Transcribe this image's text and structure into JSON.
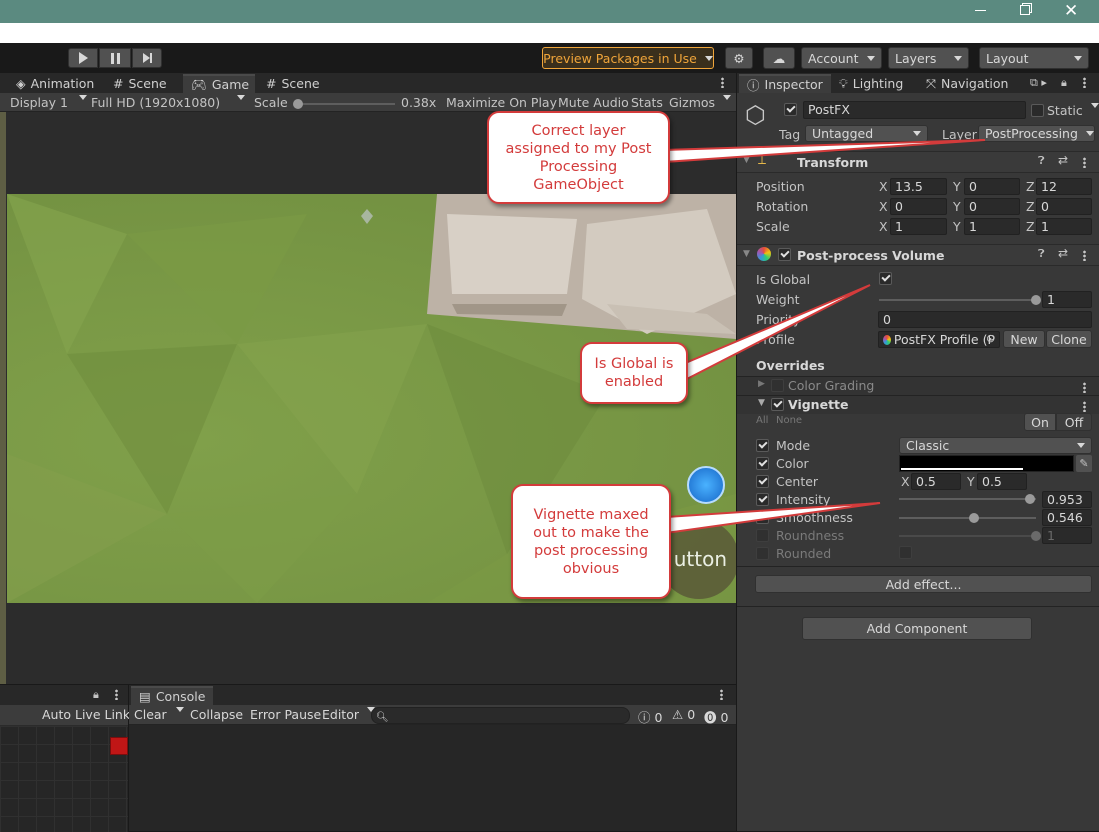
{
  "toolbar": {
    "preview_packages": "Preview Packages in Use",
    "account": "Account",
    "layers": "Layers",
    "layout": "Layout"
  },
  "game_tabs": [
    {
      "label": "Animation"
    },
    {
      "label": "Scene"
    },
    {
      "label": "Game"
    },
    {
      "label": "Scene"
    }
  ],
  "game_bar": {
    "display": "Display 1",
    "resolution": "Full HD (1920x1080)",
    "scale_label": "Scale",
    "scale_value": "0.38x",
    "maximize": "Maximize On Play",
    "mute": "Mute Audio",
    "stats": "Stats",
    "gizmos": "Gizmos"
  },
  "game_view": {
    "button_text": "utton"
  },
  "inspector_tabs": [
    {
      "label": "Inspector"
    },
    {
      "label": "Lighting"
    },
    {
      "label": "Navigation"
    }
  ],
  "gameobject": {
    "name": "PostFX",
    "static": "Static",
    "tag_label": "Tag",
    "tag": "Untagged",
    "layer_label": "Layer",
    "layer": "PostProcessing"
  },
  "transform": {
    "title": "Transform",
    "position": {
      "label": "Position",
      "x": "13.5",
      "y": "0",
      "z": "12"
    },
    "rotation": {
      "label": "Rotation",
      "x": "0",
      "y": "0",
      "z": "0"
    },
    "scale": {
      "label": "Scale",
      "x": "1",
      "y": "1",
      "z": "1"
    }
  },
  "axes": {
    "x": "X",
    "y": "Y",
    "z": "Z"
  },
  "volume": {
    "title": "Post-process Volume",
    "is_global": "Is Global",
    "weight_label": "Weight",
    "weight": "1",
    "weight_fraction": 1.0,
    "priority_label": "Priority",
    "priority": "0",
    "profile_label": "Profile",
    "profile": "PostFX Profile (P",
    "new": "New",
    "clone": "Clone",
    "overrides": "Overrides",
    "color_grading": "Color Grading",
    "vignette": "Vignette",
    "all": "All",
    "none": "None",
    "on": "On",
    "off": "Off"
  },
  "vignette": {
    "mode_label": "Mode",
    "mode": "Classic",
    "color_label": "Color",
    "center_label": "Center",
    "center_x": "0.5",
    "center_y": "0.5",
    "intensity_label": "Intensity",
    "intensity": "0.953",
    "intensity_fraction": 0.953,
    "smoothness_label": "Smoothness",
    "smoothness": "0.546",
    "smoothness_fraction": 0.546,
    "roundness_label": "Roundness",
    "roundness": "1",
    "roundness_fraction": 1.0,
    "rounded_label": "Rounded"
  },
  "buttons": {
    "add_effect": "Add effect...",
    "add_component": "Add Component"
  },
  "bottom": {
    "auto_live_link": "Auto Live Link",
    "console_tab": "Console",
    "clear": "Clear",
    "collapse": "Collapse",
    "error_pause": "Error Pause",
    "editor": "Editor",
    "count_info": "0",
    "count_warn": "0",
    "count_error": "0"
  },
  "callouts": {
    "layer": "Correct layer assigned to my Post Processing GameObject",
    "global": "Is Global is enabled",
    "vignette": "Vignette maxed out to make the post processing obvious"
  },
  "colors": {
    "title_bar": "#5b8a80",
    "accent_orange": "#f0a53a",
    "callout_red": "#d33b3b",
    "grass": "#7c9a47"
  }
}
